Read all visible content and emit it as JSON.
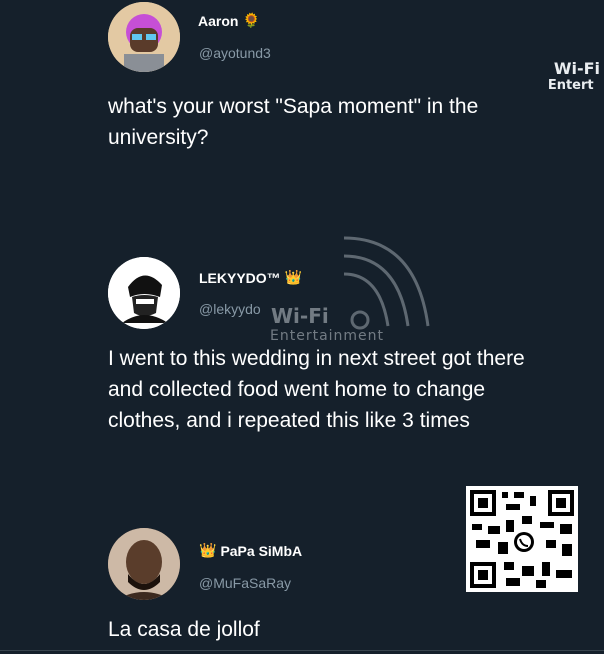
{
  "tweets": [
    {
      "name": "Aaron",
      "name_badge": "🌻",
      "handle": "@ayotund3",
      "text_lines": [
        "what's your worst \"Sapa moment\" in the",
        "university?"
      ]
    },
    {
      "name": "LEKYYDO™",
      "name_badge": "👑",
      "handle": "@lekyydo",
      "text_lines": [
        "I went to this wedding in next street got there",
        "and collected food went home to change",
        "clothes,  and i repeated this like 3 times"
      ]
    },
    {
      "name": "PaPa SiMbA",
      "name_badge": "👑",
      "handle": "@MuFaSaRay",
      "text_lines": [
        "La casa de jollof"
      ]
    }
  ],
  "watermark": {
    "top_line1": "Wi-Fi",
    "top_line2": "Entert",
    "center_line1": "Wi-Fi",
    "center_line2": "Entertainment"
  },
  "colors": {
    "background": "#15202b",
    "text": "#ffffff",
    "handle": "#8899a6"
  }
}
